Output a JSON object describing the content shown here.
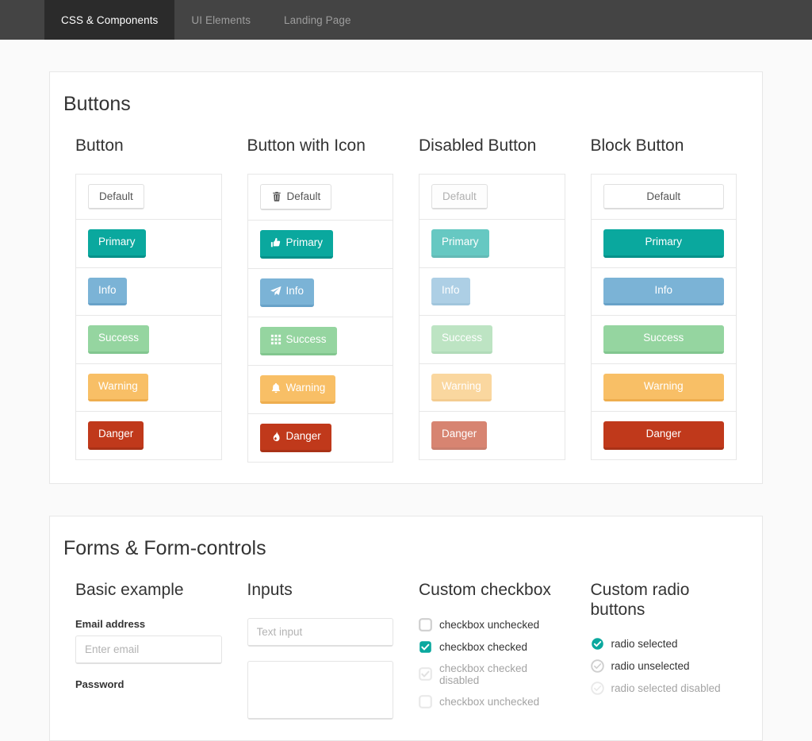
{
  "navbar": {
    "tabs": [
      {
        "label": "CSS & Components",
        "active": true
      },
      {
        "label": "UI Elements",
        "active": false
      },
      {
        "label": "Landing Page",
        "active": false
      }
    ]
  },
  "buttons_card": {
    "title": "Buttons",
    "columns": [
      {
        "title": "Button"
      },
      {
        "title": "Button with Icon"
      },
      {
        "title": "Disabled Button"
      },
      {
        "title": "Block Button"
      }
    ],
    "variants": [
      {
        "label": "Default",
        "icon": "trash-icon",
        "style": "default"
      },
      {
        "label": "Primary",
        "icon": "thumbs-up-icon",
        "style": "primary"
      },
      {
        "label": "Info",
        "icon": "paper-plane-icon",
        "style": "info"
      },
      {
        "label": "Success",
        "icon": "grid-icon",
        "style": "success"
      },
      {
        "label": "Warning",
        "icon": "bell-icon",
        "style": "warning"
      },
      {
        "label": "Danger",
        "icon": "fire-icon",
        "style": "danger"
      }
    ]
  },
  "forms_card": {
    "title": "Forms & Form-controls",
    "basic": {
      "title": "Basic example",
      "email_label": "Email address",
      "email_placeholder": "Enter email",
      "password_label": "Password"
    },
    "inputs": {
      "title": "Inputs",
      "text_placeholder": "Text input",
      "textarea_placeholder": ""
    },
    "checkbox": {
      "title": "Custom checkbox",
      "items": [
        {
          "label": "checkbox unchecked",
          "checked": false,
          "disabled": false
        },
        {
          "label": "checkbox checked",
          "checked": true,
          "disabled": false
        },
        {
          "label": "checkbox checked disabled",
          "checked": true,
          "disabled": true
        },
        {
          "label": "checkbox unchecked",
          "checked": false,
          "disabled": true
        }
      ]
    },
    "radio": {
      "title": "Custom radio buttons",
      "items": [
        {
          "label": "radio selected",
          "selected": true,
          "disabled": false
        },
        {
          "label": "radio unselected",
          "selected": false,
          "disabled": false
        },
        {
          "label": "radio selected disabled",
          "selected": true,
          "disabled": true
        }
      ]
    }
  },
  "colors": {
    "navbar_bg": "#444444",
    "navbar_active_bg": "#2b2b2b",
    "primary": "#0aa89e",
    "info": "#7bb3d6",
    "success": "#95d5a0",
    "warning": "#f8bf66",
    "danger": "#c0391b",
    "page_bg": "#fafafa"
  }
}
